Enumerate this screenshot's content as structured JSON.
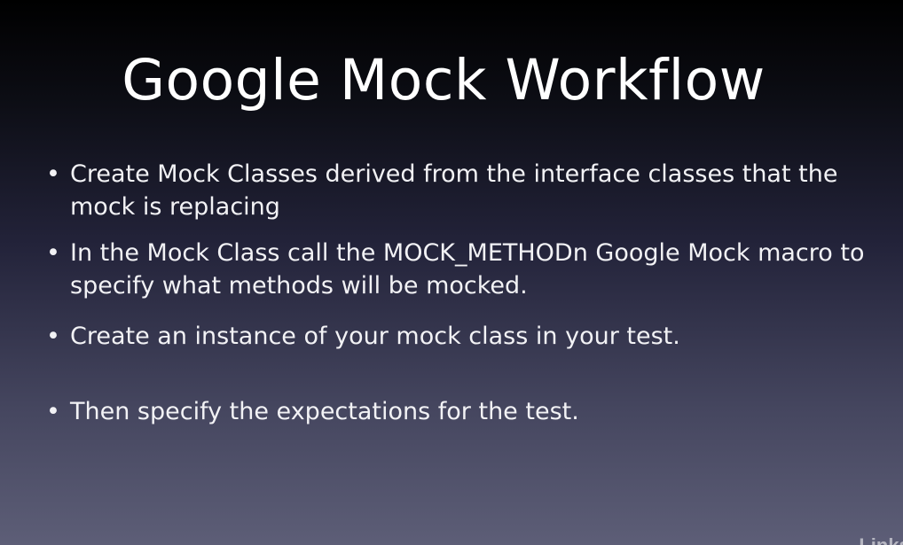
{
  "slide": {
    "title": "Google Mock Workflow",
    "bullet_glyph": "•",
    "bullets": [
      {
        "text": "Create Mock Classes derived from the interface classes that the mock is replacing"
      },
      {
        "text": "In the Mock Class call the MOCK_METHODn Google Mock macro to specify what methods will be mocked."
      },
      {
        "text": "Create an instance of your mock class in your test."
      },
      {
        "text": "Then specify the expectations for the test."
      }
    ]
  },
  "watermark": {
    "text": "Linkε"
  },
  "colors": {
    "background_top": "#000000",
    "background_bottom": "#5d5e77",
    "text": "#ffffff"
  }
}
